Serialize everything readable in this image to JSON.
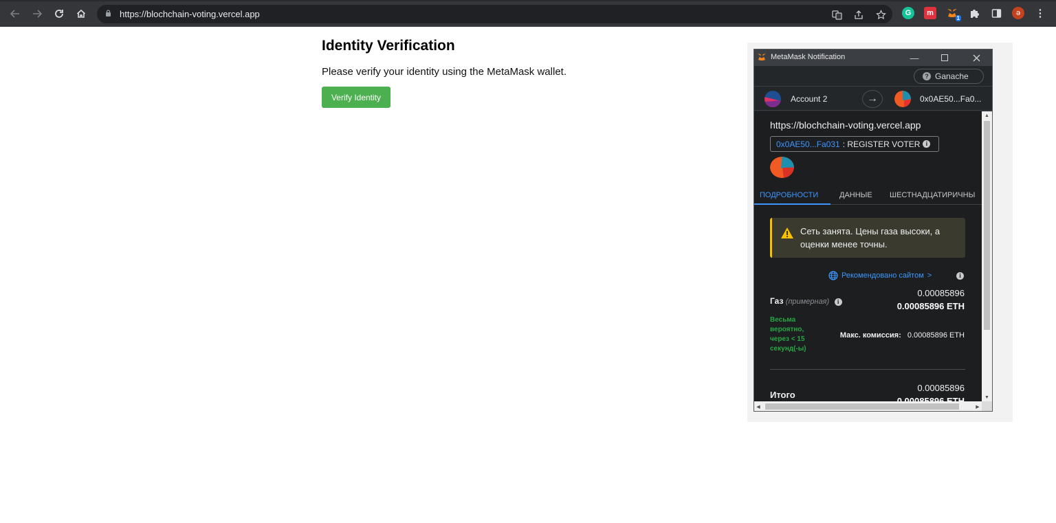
{
  "browser": {
    "url_host": "https://blochchain-voting.vercel.app",
    "back_icon": "arrow-left-icon",
    "profile_initial": "ә",
    "extension_badge": "1"
  },
  "page": {
    "title": "Identity Verification",
    "instruction": "Please verify your identity using the MetaMask wallet.",
    "verify_button": "Verify Identity",
    "verify_button_color": "#4caf50"
  },
  "metamask": {
    "window_title": "MetaMask Notification",
    "network": "Ganache",
    "from_account": "Account 2",
    "to_address": "0x0AE50...Fa0...",
    "origin": "https://blochchain-voting.vercel.app",
    "method_address": "0x0AE50...Fa031",
    "method_name": ": REGISTER VOTER",
    "tabs": [
      "ПОДРОБНОСТИ",
      "ДАННЫЕ",
      "ШЕСТНАДЦАТИРИЧНЫ"
    ],
    "warning": "Сеть занята. Цены газа высоки, а оценки менее точны.",
    "recommended": "Рекомендовано сайтом",
    "recommended_chevron": ">",
    "gas_label": "Газ",
    "gas_estimate_label": "(примерная)",
    "gas_value": "0.00085896",
    "gas_value_eth": "0.00085896 ETH",
    "likely_text": "Весьма вероятно, через < 15 секунд(-ы)",
    "max_fee_label": "Макс. комиссия:",
    "max_fee_value": "0.00085896 ETH",
    "total_label": "Итого",
    "total_value": "0.00085896",
    "total_value_eth": "0.00085896 ETH",
    "accent_color": "#3e97ff",
    "warning_color": "#f8c000",
    "success_color": "#28a745"
  }
}
